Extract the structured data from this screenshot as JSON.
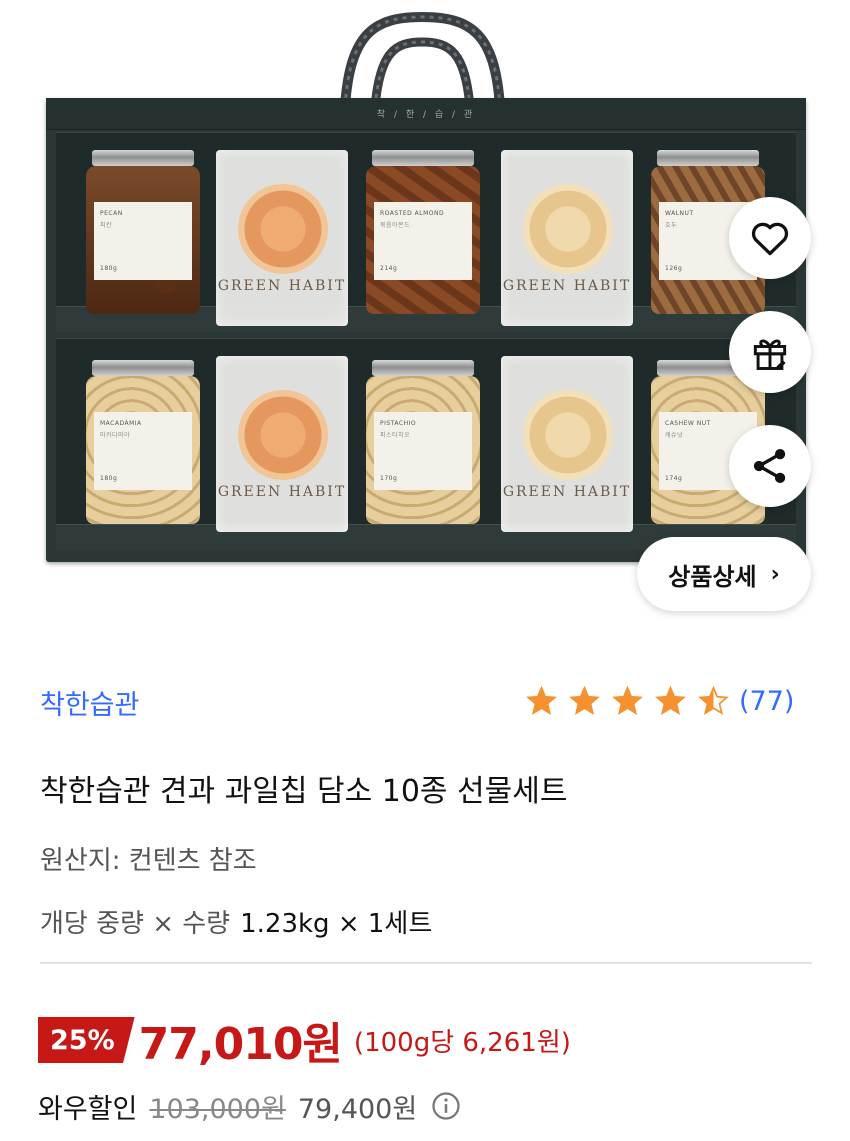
{
  "hero": {
    "box_brand_mark": "착 / 한 / 습 / 관",
    "top_row": [
      {
        "kind": "jar",
        "name": "PECAN",
        "sub": "피칸",
        "weight": "180g",
        "fill": "pecan"
      },
      {
        "kind": "bag",
        "logo": "GREEN HABIT",
        "chip": "orange"
      },
      {
        "kind": "jar",
        "name": "ROASTED ALMOND",
        "sub": "볶음아몬드",
        "weight": "214g",
        "fill": "almond"
      },
      {
        "kind": "bag",
        "logo": "GREEN HABIT",
        "chip": "pale"
      },
      {
        "kind": "jar",
        "name": "WALNUT",
        "sub": "호두",
        "weight": "126g",
        "fill": "walnut"
      }
    ],
    "bottom_row": [
      {
        "kind": "jar",
        "name": "MACADAMIA",
        "sub": "마카다미아",
        "weight": "180g",
        "fill": "light"
      },
      {
        "kind": "bag",
        "logo": "GREEN HABIT",
        "chip": "orange"
      },
      {
        "kind": "jar",
        "name": "PISTACHIO",
        "sub": "피스타치오",
        "weight": "170g",
        "fill": "light"
      },
      {
        "kind": "bag",
        "logo": "GREEN HABIT",
        "chip": "pale"
      },
      {
        "kind": "jar",
        "name": "CASHEW NUT",
        "sub": "캐슈넛",
        "weight": "174g",
        "fill": "light"
      }
    ]
  },
  "actions": {
    "wishlist_icon": "heart-icon",
    "gift_icon": "gift-icon",
    "share_icon": "share-icon",
    "detail_label": "상품상세",
    "detail_chevron": "›"
  },
  "product": {
    "brand": "착한습관",
    "rating_stars": 4.5,
    "rating_count": "(77)",
    "title": "착한습관 견과 과일칩 담소 10종 선물세트",
    "origin": "원산지: 컨텐츠 참조",
    "weight_label": "개당 중량 × 수량",
    "weight_value": "1.23kg × 1세트"
  },
  "price": {
    "discount": "25%",
    "sale_price": "77,010원",
    "unit_price": "(100g당 6,261원)",
    "wow_label": "와우할인",
    "original_price": "103,000원",
    "wow_price": "79,400원",
    "info_icon": "info-icon"
  },
  "colors": {
    "brand_blue": "#346aff",
    "price_red": "#c71818",
    "star_orange": "#f5922f",
    "box_green": "#2b3636"
  }
}
